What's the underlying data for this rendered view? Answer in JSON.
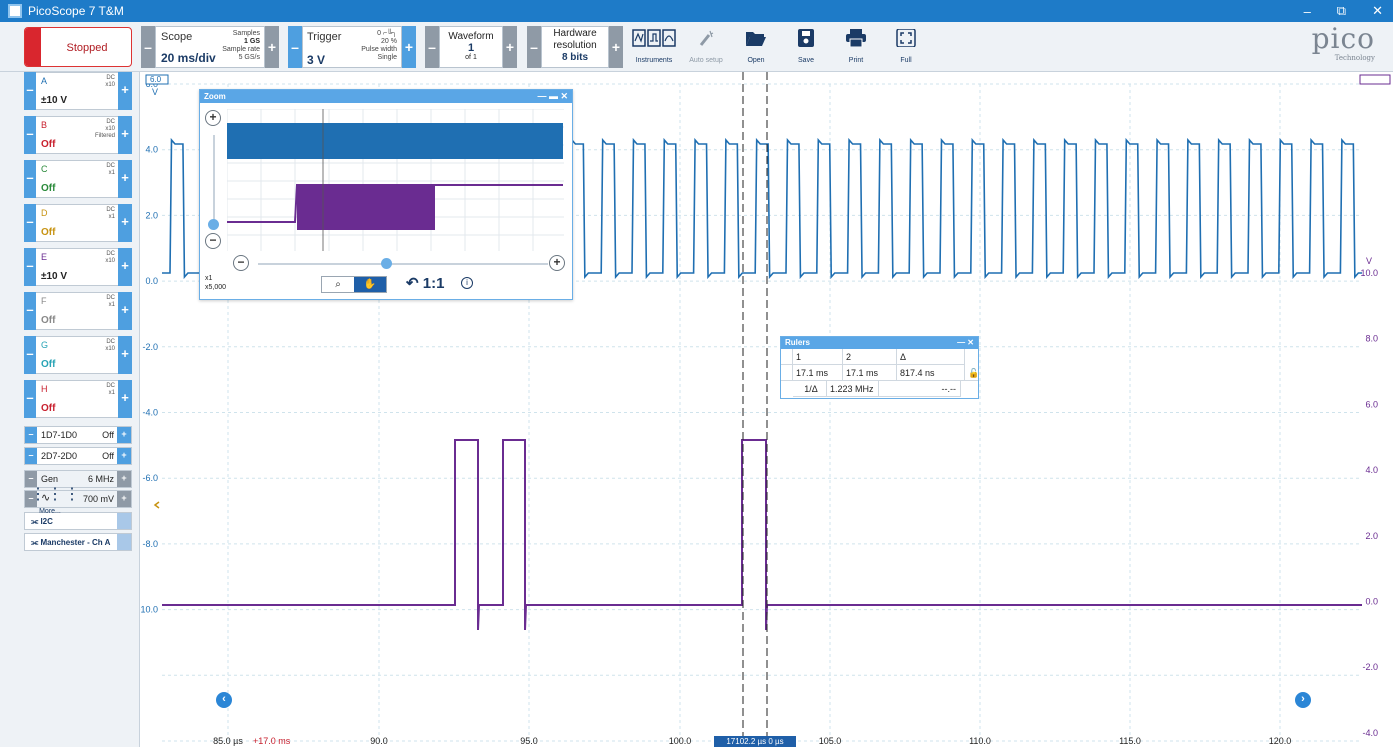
{
  "window": {
    "title": "PicoScope 7 T&M",
    "buttons": [
      "–",
      "⧉",
      "✕"
    ]
  },
  "toolbar": {
    "run_state": "Stopped",
    "scope": {
      "label": "Scope",
      "timebase": "20 ms/div",
      "samples_label": "Samples",
      "samples": "1 GS",
      "rate_label": "Sample rate",
      "rate": "5 GS/s"
    },
    "trigger": {
      "label": "Trigger",
      "level": "3 V",
      "edge": "0",
      "percent": "20 %",
      "mode": "Pulse width",
      "repeat": "Single"
    },
    "waveform": {
      "label": "Waveform",
      "index": "1",
      "count": "of 1"
    },
    "hardware": {
      "label1": "Hardware",
      "label2": "resolution",
      "bits": "8 bits"
    },
    "tools": {
      "instruments": "Instruments",
      "auto_setup": "Auto setup",
      "open": "Open",
      "save": "Save",
      "print": "Print",
      "full": "Full"
    },
    "logo": {
      "brand": "pico",
      "sub": "Technology"
    }
  },
  "channels": [
    {
      "name": "A",
      "coupling": "DC",
      "probe": "x10",
      "filter": "",
      "range": "±10 V",
      "color": "#1f6fb2"
    },
    {
      "name": "B",
      "coupling": "DC",
      "probe": "x10",
      "filter": "Filtered",
      "range": "Off",
      "color": "#c8202e"
    },
    {
      "name": "C",
      "coupling": "DC",
      "probe": "x1",
      "filter": "",
      "range": "Off",
      "color": "#2a8a3a"
    },
    {
      "name": "D",
      "coupling": "DC",
      "probe": "x1",
      "filter": "",
      "range": "Off",
      "color": "#c79312"
    },
    {
      "name": "E",
      "coupling": "DC",
      "probe": "x10",
      "filter": "",
      "range": "±10 V",
      "color": "#6a2c91"
    },
    {
      "name": "F",
      "coupling": "DC",
      "probe": "x1",
      "filter": "",
      "range": "Off",
      "color": "#888888"
    },
    {
      "name": "G",
      "coupling": "DC",
      "probe": "x10",
      "filter": "",
      "range": "Off",
      "color": "#27a3b5"
    },
    {
      "name": "H",
      "coupling": "DC",
      "probe": "x1",
      "filter": "",
      "range": "Off",
      "color": "#c8202e"
    }
  ],
  "digital": [
    {
      "name": "1D7-1D0",
      "state": "Off"
    },
    {
      "name": "2D7-2D0",
      "state": "Off"
    }
  ],
  "generator": {
    "label": "Gen",
    "freq": "6 MHz",
    "ampl": "700 mV"
  },
  "decoders": [
    {
      "name": "I2C"
    },
    {
      "name": "Manchester - Ch A"
    }
  ],
  "more_label": "More...",
  "axis": {
    "left_unit": "V",
    "left_ticks": [
      "6.0",
      "4.0",
      "2.0",
      "0.0",
      "-2.0",
      "-4.0",
      "-6.0",
      "-8.0",
      "-10.0"
    ],
    "right_unit": "V",
    "right_ticks": [
      "10.0",
      "8.0",
      "6.0",
      "4.0",
      "2.0",
      "0.0",
      "-2.0",
      "-4.0"
    ],
    "x_ticks": [
      "85.0 µs",
      "90.0",
      "95.0",
      "100.0",
      "105.0",
      "110.0",
      "115.0",
      "120.0"
    ],
    "x_offset": "+17.0 ms"
  },
  "cursor_badge": "17102.2 µs   0 µs",
  "zoom": {
    "title": "Zoom",
    "x_factor": "x1",
    "y_factor": "x5,000",
    "reset_label": "1:1"
  },
  "rulers": {
    "title": "Rulers",
    "headers": [
      "1",
      "2",
      "Δ"
    ],
    "values": [
      "17.1 ms",
      "17.1 ms",
      "817.4 ns"
    ],
    "freq_label": "1/Δ",
    "freq": "1.223 MHz",
    "freq_2": "--.--"
  },
  "colors": {
    "channel_a": "#1f6fb2",
    "channel_e": "#6a2c91",
    "accent": "#4e9fe0",
    "stop": "#d9262e"
  }
}
